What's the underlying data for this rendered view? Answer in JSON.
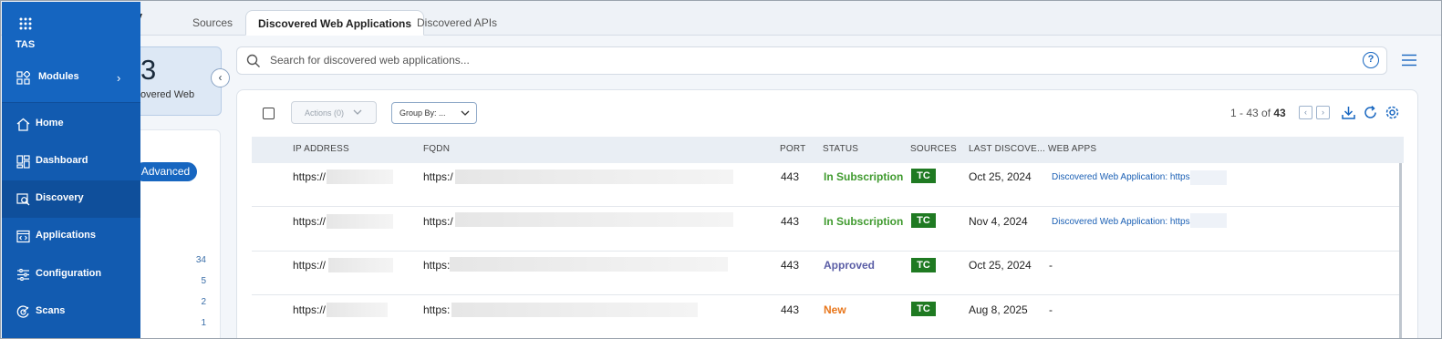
{
  "tabs": [
    {
      "label": "Sources"
    },
    {
      "label": "Discovered Web Applications"
    },
    {
      "label": "Discovered APIs"
    }
  ],
  "summary": {
    "number": "3",
    "label": "overed Web"
  },
  "filters": {
    "advanced_label": "Advanced",
    "counts": [
      "34",
      "5",
      "2",
      "1"
    ]
  },
  "search": {
    "placeholder": "Search for discovered web applications..."
  },
  "toolbar": {
    "actions_label": "Actions (0)",
    "groupby_label": "Group By: ...",
    "pager_range": "1 - 43 of",
    "pager_total": "43"
  },
  "table": {
    "headers": [
      "IP ADDRESS",
      "FQDN",
      "PORT",
      "STATUS",
      "SOURCES",
      "LAST DISCOVE...",
      "WEB APPS"
    ],
    "rows": [
      {
        "ip": "https://",
        "fqdn": "https:/",
        "port": "443",
        "status": "In Subscription",
        "status_color": "#3f9a2e",
        "source": "TC",
        "last": "Oct 25, 2024",
        "webapp": "Discovered Web Application: https://"
      },
      {
        "ip": "https://",
        "fqdn": "https:/",
        "port": "443",
        "status": "In Subscription",
        "status_color": "#3f9a2e",
        "source": "TC",
        "last": "Nov 4, 2024",
        "webapp": "Discovered Web Application: https://"
      },
      {
        "ip": "https://",
        "fqdn": "https:",
        "port": "443",
        "status": "Approved",
        "status_color": "#5b5ea6",
        "source": "TC",
        "last": "Oct 25, 2024",
        "webapp": "-"
      },
      {
        "ip": "https://",
        "fqdn": "https:",
        "port": "443",
        "status": "New",
        "status_color": "#e8761b",
        "source": "TC",
        "last": "Aug 8, 2025",
        "webapp": "-"
      }
    ]
  },
  "sidebar": {
    "brand": "TAS",
    "items": [
      {
        "label": "Modules",
        "icon": "modules-icon"
      },
      {
        "label": "Home",
        "icon": "home-icon"
      },
      {
        "label": "Dashboard",
        "icon": "dashboard-icon"
      },
      {
        "label": "Discovery",
        "icon": "discovery-icon"
      },
      {
        "label": "Applications",
        "icon": "applications-icon"
      },
      {
        "label": "Configuration",
        "icon": "configuration-icon"
      },
      {
        "label": "Scans",
        "icon": "scans-icon"
      }
    ]
  },
  "colors": {
    "sidebar": "#1565c0",
    "accent": "#1766c0",
    "badge_green": "#1f7a22"
  }
}
